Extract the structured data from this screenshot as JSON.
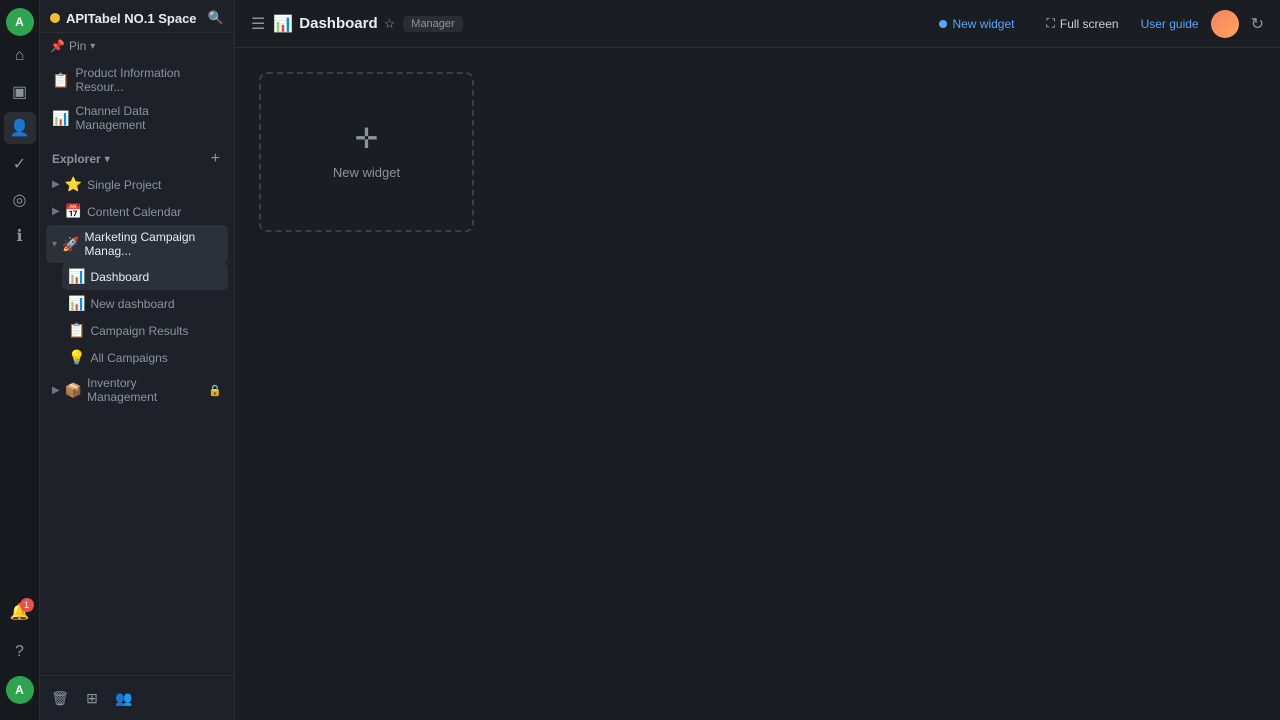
{
  "app": {
    "space_name": "APITabel NO.1 Space",
    "space_dot_color": "#f0c030"
  },
  "sidebar": {
    "pin_label": "Pin",
    "explorer_label": "Explorer",
    "pinned_items": [
      {
        "id": "product-info",
        "label": "Product Information Resour...",
        "icon": "📋"
      },
      {
        "id": "channel-data",
        "label": "Channel Data Management",
        "icon": "📊"
      }
    ],
    "tree_items": [
      {
        "id": "single-project",
        "label": "Single Project",
        "icon": "⭐",
        "expanded": false,
        "children": []
      },
      {
        "id": "content-calendar",
        "label": "Content Calendar",
        "icon": "📅",
        "expanded": false,
        "children": []
      },
      {
        "id": "marketing-campaign",
        "label": "Marketing Campaign Manag...",
        "icon": "🚀",
        "expanded": true,
        "children": [
          {
            "id": "dashboard",
            "label": "Dashboard",
            "icon": "📊",
            "active": true
          },
          {
            "id": "new-dashboard",
            "label": "New dashboard",
            "icon": "📊"
          },
          {
            "id": "campaign-results",
            "label": "Campaign Results",
            "icon": "📋"
          },
          {
            "id": "all-campaigns",
            "label": "All Campaigns",
            "icon": "💡"
          }
        ]
      },
      {
        "id": "inventory-management",
        "label": "Inventory Management",
        "icon": "📦",
        "locked": true
      }
    ]
  },
  "topbar": {
    "page_icon": "📊",
    "page_title": "Dashboard",
    "role_badge": "Manager",
    "new_widget_label": "New widget",
    "fullscreen_label": "Full screen",
    "user_guide_label": "User guide"
  },
  "dashboard": {
    "new_widget_label": "New widget",
    "plus_symbol": "+"
  }
}
